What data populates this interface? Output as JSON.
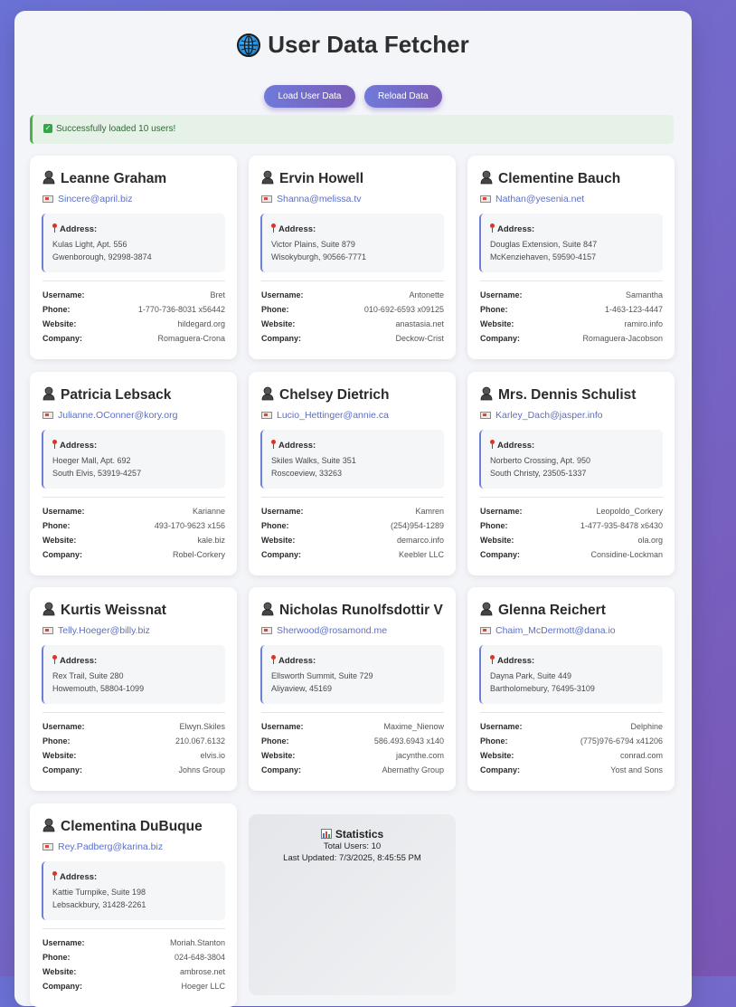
{
  "app": {
    "title": "User Data Fetcher",
    "buttons": {
      "load": "Load User Data",
      "reload": "Reload Data"
    },
    "status": "Successfully loaded 10 users!"
  },
  "labels": {
    "address": "Address:",
    "username": "Username:",
    "phone": "Phone:",
    "website": "Website:",
    "company": "Company:"
  },
  "users": [
    {
      "name": "Leanne Graham",
      "email": "Sincere@april.biz",
      "addr1": "Kulas Light, Apt. 556",
      "addr2": "Gwenborough, 92998-3874",
      "username": "Bret",
      "phone": "1-770-736-8031 x56442",
      "website": "hildegard.org",
      "company": "Romaguera-Crona"
    },
    {
      "name": "Ervin Howell",
      "email": "Shanna@melissa.tv",
      "addr1": "Victor Plains, Suite 879",
      "addr2": "Wisokyburgh, 90566-7771",
      "username": "Antonette",
      "phone": "010-692-6593 x09125",
      "website": "anastasia.net",
      "company": "Deckow-Crist"
    },
    {
      "name": "Clementine Bauch",
      "email": "Nathan@yesenia.net",
      "addr1": "Douglas Extension, Suite 847",
      "addr2": "McKenziehaven, 59590-4157",
      "username": "Samantha",
      "phone": "1-463-123-4447",
      "website": "ramiro.info",
      "company": "Romaguera-Jacobson"
    },
    {
      "name": "Patricia Lebsack",
      "email": "Julianne.OConner@kory.org",
      "addr1": "Hoeger Mall, Apt. 692",
      "addr2": "South Elvis, 53919-4257",
      "username": "Karianne",
      "phone": "493-170-9623 x156",
      "website": "kale.biz",
      "company": "Robel-Corkery"
    },
    {
      "name": "Chelsey Dietrich",
      "email": "Lucio_Hettinger@annie.ca",
      "addr1": "Skiles Walks, Suite 351",
      "addr2": "Roscoeview, 33263",
      "username": "Kamren",
      "phone": "(254)954-1289",
      "website": "demarco.info",
      "company": "Keebler LLC"
    },
    {
      "name": "Mrs. Dennis Schulist",
      "email": "Karley_Dach@jasper.info",
      "addr1": "Norberto Crossing, Apt. 950",
      "addr2": "South Christy, 23505-1337",
      "username": "Leopoldo_Corkery",
      "phone": "1-477-935-8478 x6430",
      "website": "ola.org",
      "company": "Considine-Lockman"
    },
    {
      "name": "Kurtis Weissnat",
      "email": "Telly.Hoeger@billy.biz",
      "addr1": "Rex Trail, Suite 280",
      "addr2": "Howemouth, 58804-1099",
      "username": "Elwyn.Skiles",
      "phone": "210.067.6132",
      "website": "elvis.io",
      "company": "Johns Group"
    },
    {
      "name": "Nicholas Runolfsdottir V",
      "email": "Sherwood@rosamond.me",
      "addr1": "Ellsworth Summit, Suite 729",
      "addr2": "Aliyaview, 45169",
      "username": "Maxime_Nienow",
      "phone": "586.493.6943 x140",
      "website": "jacynthe.com",
      "company": "Abernathy Group"
    },
    {
      "name": "Glenna Reichert",
      "email": "Chaim_McDermott@dana.io",
      "addr1": "Dayna Park, Suite 449",
      "addr2": "Bartholomebury, 76495-3109",
      "username": "Delphine",
      "phone": "(775)976-6794 x41206",
      "website": "conrad.com",
      "company": "Yost and Sons"
    },
    {
      "name": "Clementina DuBuque",
      "email": "Rey.Padberg@karina.biz",
      "addr1": "Kattie Turnpike, Suite 198",
      "addr2": "Lebsackbury, 31428-2261",
      "username": "Moriah.Stanton",
      "phone": "024-648-3804",
      "website": "ambrose.net",
      "company": "Hoeger LLC"
    }
  ],
  "stats": {
    "title": "Statistics",
    "total": "Total Users: 10",
    "updated": "Last Updated: 7/3/2025, 8:45:55 PM"
  }
}
